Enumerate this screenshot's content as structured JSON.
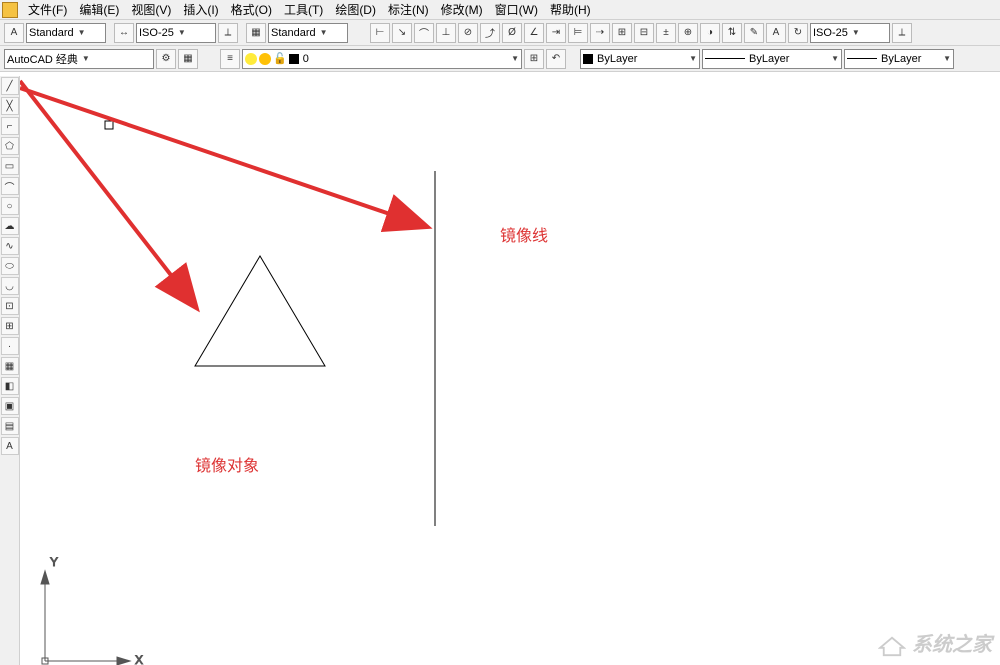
{
  "menubar": {
    "items": [
      "文件(F)",
      "编辑(E)",
      "视图(V)",
      "插入(I)",
      "格式(O)",
      "工具(T)",
      "绘图(D)",
      "标注(N)",
      "修改(M)",
      "窗口(W)",
      "帮助(H)"
    ]
  },
  "toolbar1": {
    "text_style_label": "Standard",
    "dim_style_label": "ISO-25",
    "std_label2": "Standard",
    "iso25_right": "ISO-25"
  },
  "toolbar2": {
    "workspace_label": "AutoCAD 经典",
    "layer_name": "0",
    "bylayer1": "ByLayer",
    "bylayer2": "ByLayer",
    "bylayer3": "ByLayer"
  },
  "canvas": {
    "annotation_object": "镜像对象",
    "annotation_line": "镜像线",
    "axis_y": "Y",
    "axis_x": "X"
  },
  "watermark": "系统之家"
}
